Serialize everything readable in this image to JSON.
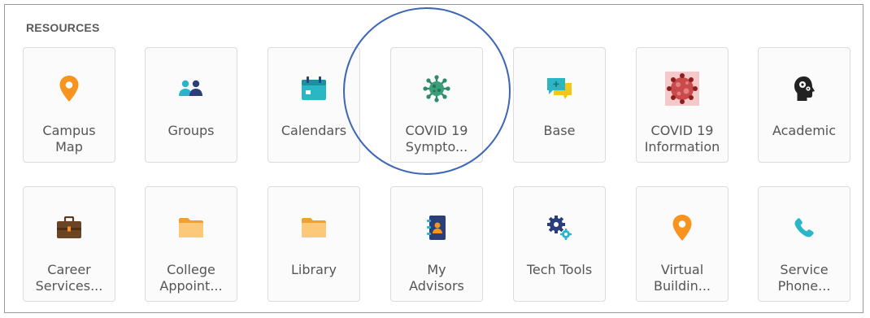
{
  "section": {
    "title": "RESOURCES"
  },
  "tiles": [
    {
      "label_1": "Campus",
      "label_2": "Map",
      "icon": "map-pin-icon"
    },
    {
      "label_1": "Groups",
      "label_2": "",
      "icon": "people-icon"
    },
    {
      "label_1": "Calendars",
      "label_2": "",
      "icon": "calendar-icon"
    },
    {
      "label_1": "COVID 19",
      "label_2": "Sympto...",
      "icon": "virus-icon"
    },
    {
      "label_1": "Base",
      "label_2": "",
      "icon": "chat-bubbles-icon"
    },
    {
      "label_1": "COVID 19",
      "label_2": "Information",
      "icon": "coronavirus-image-icon"
    },
    {
      "label_1": "Academic",
      "label_2": "",
      "icon": "head-gears-icon"
    },
    {
      "label_1": "Career",
      "label_2": "Services...",
      "icon": "briefcase-icon"
    },
    {
      "label_1": "College",
      "label_2": "Appoint...",
      "icon": "folder-icon"
    },
    {
      "label_1": "Library",
      "label_2": "",
      "icon": "folder-icon"
    },
    {
      "label_1": "My",
      "label_2": "Advisors",
      "icon": "contact-book-icon"
    },
    {
      "label_1": "Tech Tools",
      "label_2": "",
      "icon": "gears-icon"
    },
    {
      "label_1": "Virtual",
      "label_2": "Buildin...",
      "icon": "map-pin-icon"
    },
    {
      "label_1": "Service",
      "label_2": "Phone...",
      "icon": "phone-icon"
    }
  ],
  "colors": {
    "accent_orange": "#f7931e",
    "teal": "#2bb5c9",
    "navy": "#2a3f7a",
    "annotation_circle": "#3d67b5"
  }
}
